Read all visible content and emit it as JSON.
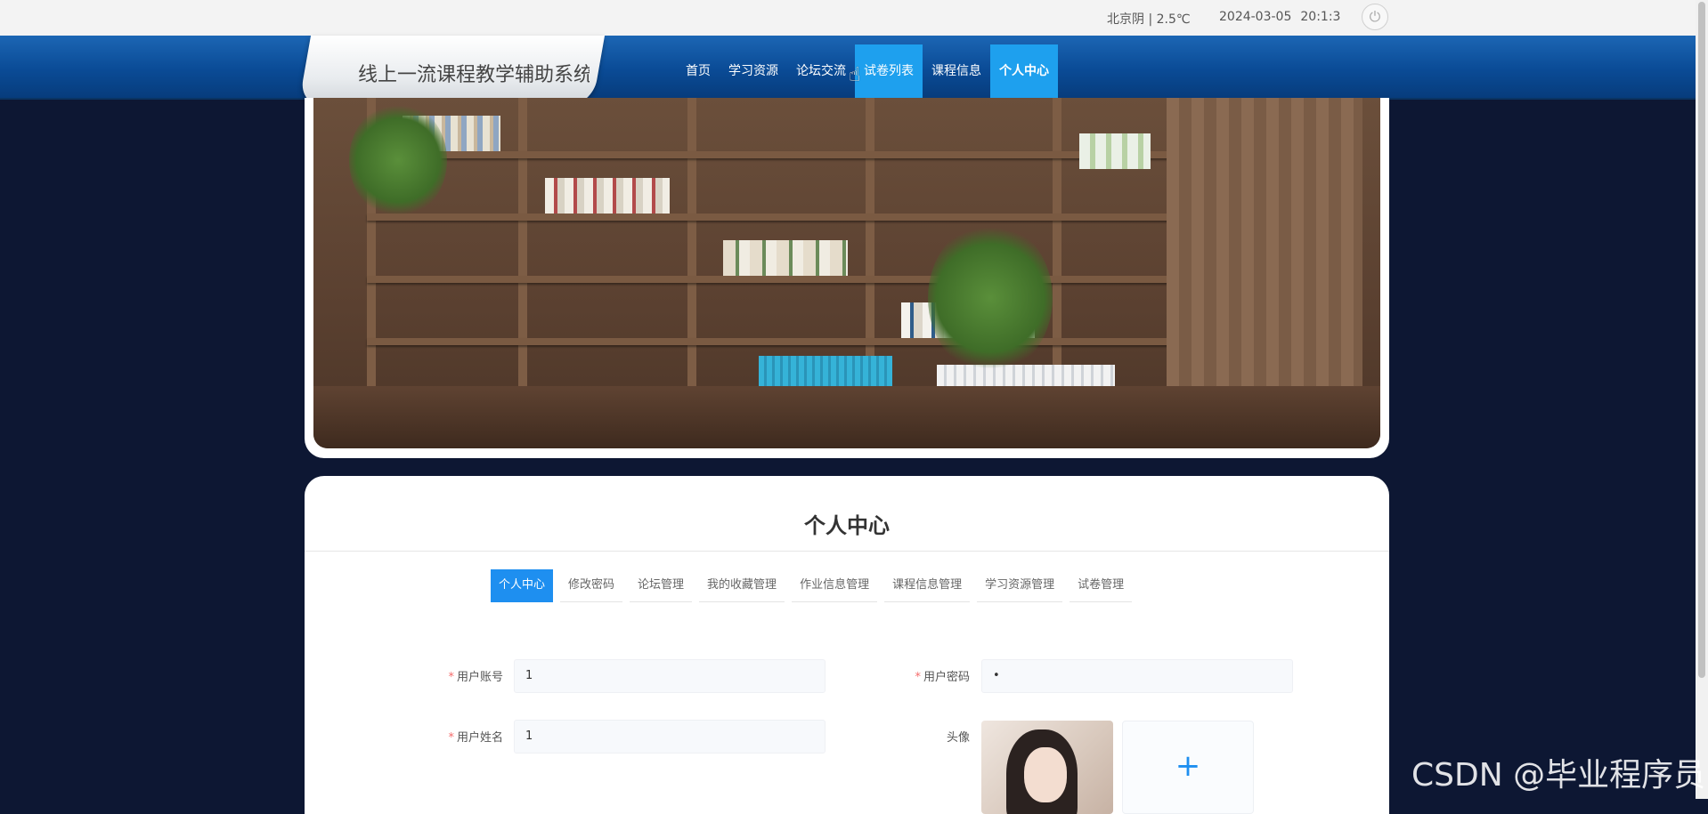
{
  "topbar": {
    "weather": "北京阴 | 2.5℃",
    "date": "2024-03-05",
    "time": "20:1:3",
    "power_icon": "power-icon"
  },
  "header": {
    "site_title": "线上一流课程教学辅助系统",
    "nav_items": [
      "首页",
      "学习资源",
      "论坛交流",
      "试卷列表",
      "课程信息",
      "个人中心"
    ],
    "hover_item": "试卷列表",
    "active_item": "个人中心"
  },
  "banner": {
    "image": "bookshelf-photo"
  },
  "profile": {
    "title": "个人中心",
    "tabs": [
      "个人中心",
      "修改密码",
      "论坛管理",
      "我的收藏管理",
      "作业信息管理",
      "课程信息管理",
      "学习资源管理",
      "试卷管理"
    ],
    "active_tab": "个人中心",
    "fields": {
      "account_label": "用户账号",
      "account_value": "1",
      "password_label": "用户密码",
      "password_value": "•",
      "name_label": "用户姓名",
      "name_value": "1",
      "avatar_label": "头像",
      "upload_symbol": "+"
    }
  },
  "watermark": "CSDN @毕业程序员",
  "colors": {
    "nav_bg": "#0a4b96",
    "nav_highlight": "#1ea0ee",
    "tab_active": "#1e8ff0",
    "page_bg": "#0d1733",
    "required": "#f56c6c"
  }
}
